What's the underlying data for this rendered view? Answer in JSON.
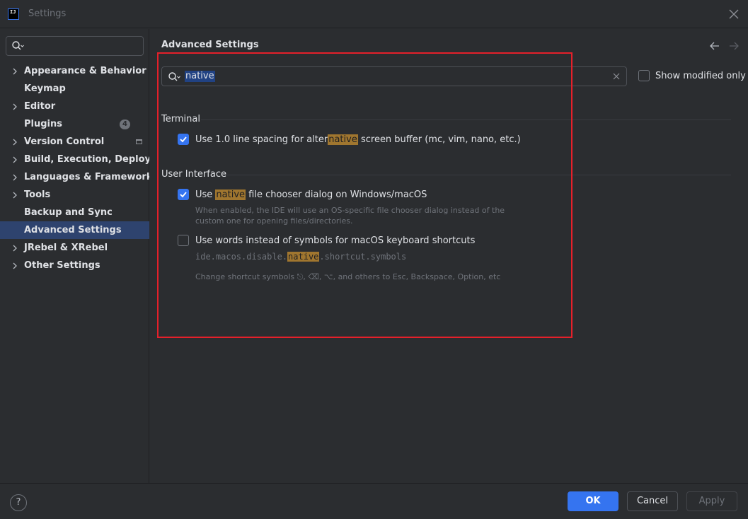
{
  "window": {
    "title": "Settings"
  },
  "sidebar": {
    "search_placeholder": "",
    "items": [
      {
        "label": "Appearance & Behavior",
        "expandable": true
      },
      {
        "label": "Keymap",
        "expandable": false
      },
      {
        "label": "Editor",
        "expandable": true
      },
      {
        "label": "Plugins",
        "expandable": false,
        "badge": "4"
      },
      {
        "label": "Version Control",
        "expandable": true
      },
      {
        "label": "Build, Execution, Deployment",
        "expandable": true
      },
      {
        "label": "Languages & Frameworks",
        "expandable": true
      },
      {
        "label": "Tools",
        "expandable": true
      },
      {
        "label": "Backup and Sync",
        "expandable": false
      },
      {
        "label": "Advanced Settings",
        "expandable": false,
        "selected": true
      },
      {
        "label": "JRebel & XRebel",
        "expandable": true
      },
      {
        "label": "Other Settings",
        "expandable": true
      }
    ]
  },
  "main": {
    "title": "Advanced Settings",
    "search": {
      "value": "native"
    },
    "show_modified_label": "Show modified only",
    "show_modified_checked": false,
    "groups": [
      {
        "title": "Terminal",
        "options": [
          {
            "label_pre": "Use 1.0 line spacing for alter",
            "label_hl": "native",
            "label_post": " screen buffer (mc, vim, nano, etc.)",
            "checked": true
          }
        ]
      },
      {
        "title": "User Interface",
        "options": [
          {
            "label_pre": "Use ",
            "label_hl": "native",
            "label_post": " file chooser dialog on Windows/macOS",
            "checked": true,
            "description_line1": "When enabled, the IDE will use an OS-specific file chooser dialog instead of the",
            "description_line2": "custom one for opening files/directories."
          },
          {
            "label": "Use words instead of symbols for macOS keyboard shortcuts",
            "checked": false,
            "key_pre": "ide.macos.disable.",
            "key_hl": "native",
            "key_post": ".shortcut.symbols",
            "description": "Change shortcut symbols ⎋, ⌫, ⌥, and others to Esc, Backspace, Option, etc"
          }
        ]
      }
    ]
  },
  "footer": {
    "help": "?",
    "ok": "OK",
    "cancel": "Cancel",
    "apply": "Apply"
  },
  "colors": {
    "accent": "#3574f0",
    "highlight": "#a0762f",
    "annotation_frame": "#e5202a",
    "background": "#2b2d30",
    "selection": "#2e436e"
  }
}
